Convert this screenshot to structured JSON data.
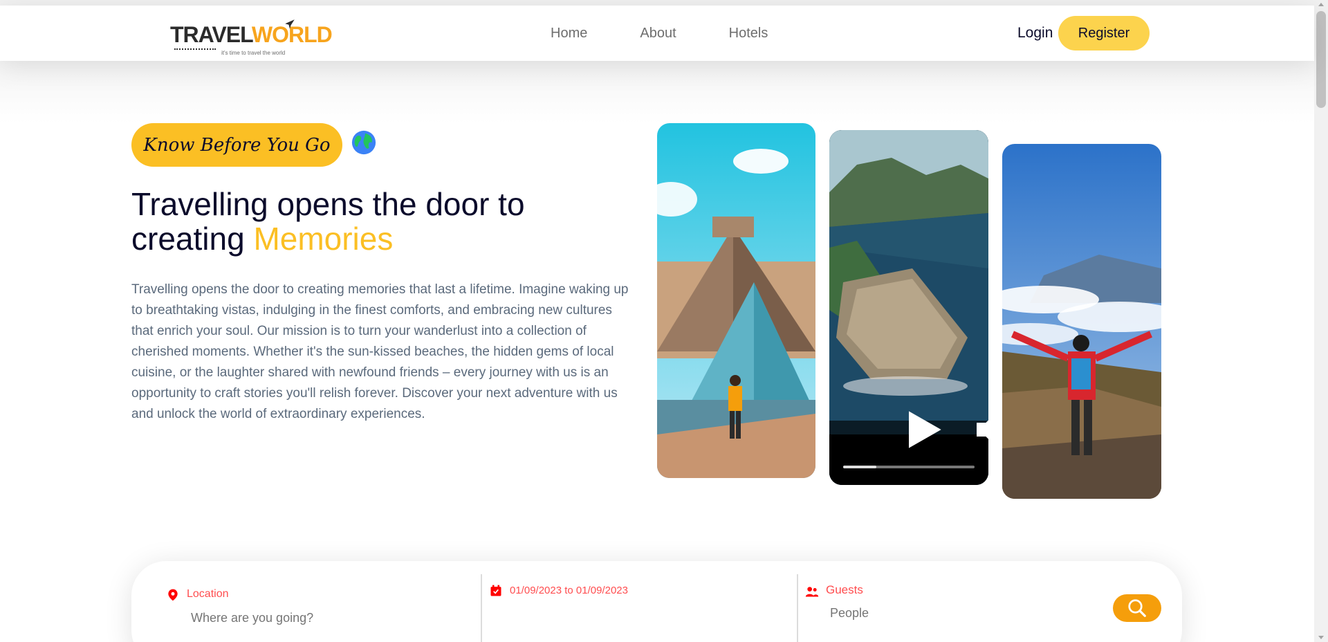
{
  "header": {
    "logo": {
      "word_dark": "TRAVEL",
      "word_accent": "WORLD",
      "tagline": "it's time to travel the world"
    },
    "nav": [
      {
        "label": "Home"
      },
      {
        "label": "About"
      },
      {
        "label": "Hotels"
      }
    ],
    "login_label": "Login",
    "register_label": "Register"
  },
  "hero": {
    "subtitle": "Know Before You Go",
    "subtitle_icon": "globe-icon",
    "title_line1": "Travelling opens the door to",
    "title_line2_prefix": "creating ",
    "title_highlight": "Memories",
    "description": "Travelling opens the door to creating memories that last a lifetime. Imagine waking up to breathtaking vistas, indulging in the finest comforts, and embracing new cultures that enrich your soul. Our mission is to turn your wanderlust into a collection of cherished moments. Whether it's the sun-kissed beaches, the hidden gems of local cuisine, or the laughter shared with newfound friends – every journey with us is an opportunity to craft stories you'll relish forever. Discover your next adventure with us and unlock the world of extraordinary experiences."
  },
  "gallery": {
    "video_progress": 0.25
  },
  "search": {
    "location_label": "Location",
    "location_placeholder": "Where are you going?",
    "date_label": "01/09/2023 to 01/09/2023",
    "guests_label": "Guests",
    "guests_placeholder": "People"
  },
  "colors": {
    "accent": "#fbbf24",
    "register_bg": "#fcd34d",
    "search_button": "#f59e0b",
    "label_red": "#ff4d4f"
  }
}
